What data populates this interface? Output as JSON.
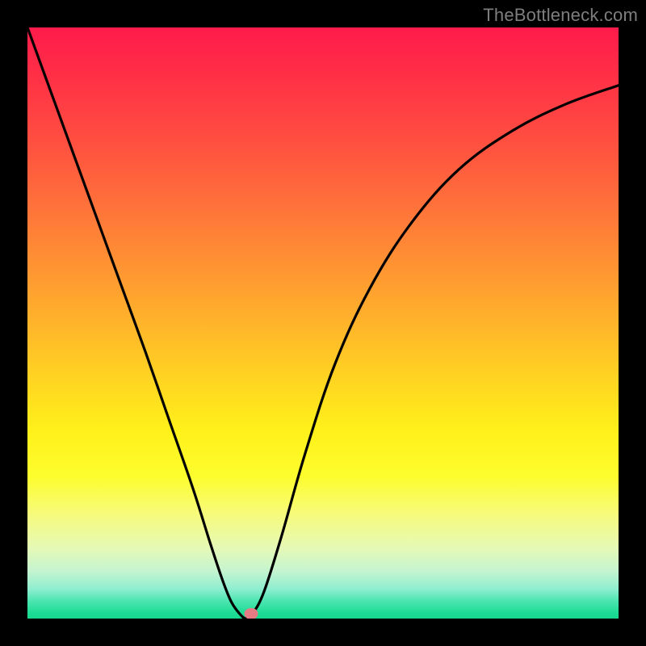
{
  "attribution": "TheBottleneck.com",
  "colors": {
    "curve_stroke": "#000000",
    "dot_fill": "#e77b84",
    "frame": "#000000"
  },
  "chart_data": {
    "type": "line",
    "title": "",
    "xlabel": "",
    "ylabel": "",
    "xlim": [
      0,
      100
    ],
    "ylim": [
      0,
      100
    ],
    "axes_visible": false,
    "grid": false,
    "curve_min_x": 37,
    "series": [
      {
        "name": "bottleneck-curve",
        "x": [
          0,
          4,
          8,
          12,
          16,
          20,
          24,
          28,
          31,
          33,
          34.5,
          36,
          37,
          38,
          40,
          43,
          47,
          52,
          58,
          65,
          73,
          82,
          91,
          100
        ],
        "y": [
          100,
          89,
          78,
          67,
          56,
          45,
          33.5,
          22,
          12.5,
          6.5,
          2.8,
          0.7,
          0,
          0.7,
          4.5,
          14,
          28,
          43,
          56,
          67,
          76,
          82.5,
          87,
          90.2
        ]
      }
    ],
    "marker": {
      "x": 37.8,
      "y": 0.8
    }
  }
}
